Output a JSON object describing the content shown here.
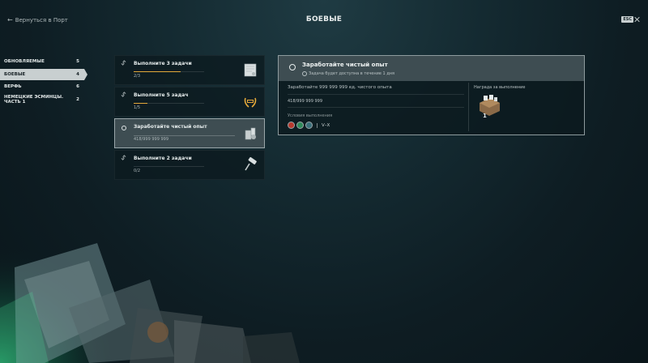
{
  "header": {
    "back_label": "Вернуться в Порт",
    "title": "БОЕВЫЕ",
    "esc_label": "ESC"
  },
  "sidebar": {
    "items": [
      {
        "label": "ОБНОВЛЯЕМЫЕ",
        "count": "5",
        "active": false
      },
      {
        "label": "БОЕВЫЕ",
        "count": "4",
        "active": true
      },
      {
        "label": "ВЕРФЬ",
        "count": "6",
        "active": false
      },
      {
        "label": "НЕМЕЦКИЕ ЭСМИНЦЫ. ЧАСТЬ 1",
        "count": "2",
        "active": false
      }
    ]
  },
  "tasks": [
    {
      "title": "Выполните 3 задачи",
      "count": "2/3",
      "progress": 0.667,
      "reward_icon": "certificate-icon"
    },
    {
      "title": "Выполните 5 задач",
      "count": "1/5",
      "progress": 0.2,
      "reward_icon": "laurel-wreath-icon"
    },
    {
      "title": "Заработайте чистый опыт",
      "count": "418/999 999 999",
      "progress": 0.0,
      "reward_icon": "supply-containers-icon"
    },
    {
      "title": "Выполните 2 задачи",
      "count": "0/2",
      "progress": 0.0,
      "reward_icon": "paint-roller-icon"
    }
  ],
  "detail": {
    "title": "Заработайте чистый опыт",
    "subtitle": "Задача будет доступна в течение 1 дня",
    "description": "Заработайте 999 999 999 ед. чистого опыта",
    "progress": "418/999 999 999",
    "conditions_label": "Условия выполнения",
    "tiers": "V–X",
    "reward_label": "Награда за выполнение",
    "reward_count": "1"
  },
  "colors": {
    "accent_progress": "#e3a83a",
    "active_bg": "#c8cfd0",
    "panel_bg": "#0c1a1f"
  }
}
